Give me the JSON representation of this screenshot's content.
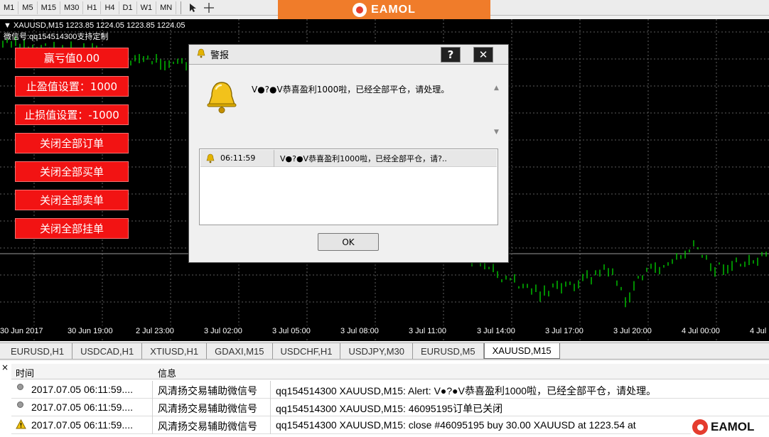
{
  "toolbar": {
    "timeframes": [
      "M1",
      "M5",
      "M15",
      "M30",
      "H1",
      "H4",
      "D1",
      "W1",
      "MN"
    ]
  },
  "brand": {
    "name": "EAMOL",
    "color": "#f07c2a"
  },
  "chart": {
    "symbol_line": "XAUUSD,M15 1223.85 1224.05 1223.85 1224.05",
    "wechat_line": "微信号:qq154514300支持定制",
    "buttons": [
      "赢亏值0.00",
      "止盈值设置：1000",
      "止损值设置：-1000",
      "关闭全部订单",
      "关闭全部买单",
      "关闭全部卖单",
      "关闭全部挂单"
    ],
    "time_labels": [
      "30 Jun 2017",
      "30 Jun 19:00",
      "2 Jul 23:00",
      "3 Jul 02:00",
      "3 Jul 05:00",
      "3 Jul 08:00",
      "3 Jul 11:00",
      "3 Jul 14:00",
      "3 Jul 17:00",
      "3 Jul 20:00",
      "4 Jul 00:00",
      "4 Jul"
    ],
    "candle_color": "#00c800",
    "button_color": "#f21313"
  },
  "dialog": {
    "title": "警报",
    "help_label": "?",
    "close_label": "✕",
    "message": "V●?●V恭喜盈利1000啦，已经全部平仓，请处理。",
    "log": {
      "time": "06:11:59",
      "message": "V●?●V恭喜盈利1000啦，已经全部平仓，请?.."
    },
    "ok_label": "OK"
  },
  "tabs": {
    "items": [
      "EURUSD,H1",
      "USDCAD,H1",
      "XTIUSD,H1",
      "GDAXI,M15",
      "USDCHF,H1",
      "USDJPY,M30",
      "EURUSD,M5",
      "XAUUSD,M15"
    ],
    "active": "XAUUSD,M15"
  },
  "terminal": {
    "close_label": "×",
    "headers": {
      "time": "时间",
      "info": "信息"
    },
    "rows": [
      {
        "time": "2017.07.05 06:11:59....",
        "source": "风清扬交易辅助微信号",
        "message": "qq154514300 XAUUSD,M15: Alert: V●?●V恭喜盈利1000啦，已经全部平仓，请处理。",
        "icon": "info-dot-icon"
      },
      {
        "time": "2017.07.05 06:11:59....",
        "source": "风清扬交易辅助微信号",
        "message": "qq154514300 XAUUSD,M15: 46095195订单已关闭",
        "icon": "info-dot-icon"
      },
      {
        "time": "2017.07.05 06:11:59....",
        "source": "风清扬交易辅助微信号",
        "message": "qq154514300 XAUUSD,M15: close #46095195 buy 30.00 XAUUSD at 1223.54 at",
        "icon": "warning-icon"
      }
    ]
  }
}
